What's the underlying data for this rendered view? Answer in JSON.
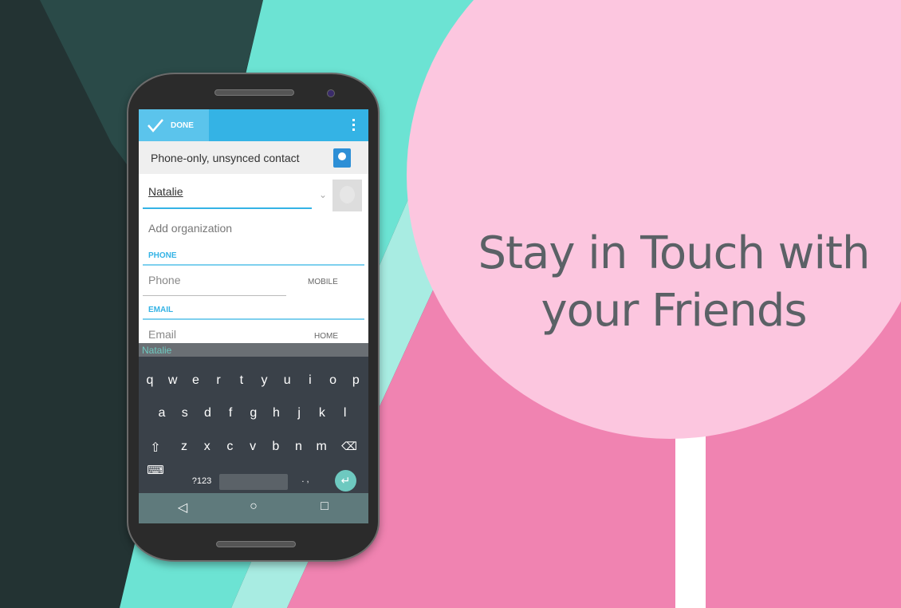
{
  "headline": {
    "line1": "Stay in Touch with",
    "line2": "your Friends"
  },
  "colors": {
    "action_bar": "#34b3e5",
    "accent": "#6ec9c0",
    "pink": "#f083b1",
    "light_pink": "#fcc6df",
    "teal": "#6ce3d3"
  },
  "action_bar": {
    "done_label": "DONE",
    "done_icon": "checkmark-icon",
    "overflow_icon": "overflow-menu-icon"
  },
  "account": {
    "label": "Phone-only, unsynced contact",
    "icon": "contact-card-icon"
  },
  "form": {
    "name_value": "Natalie",
    "org_placeholder": "Add organization",
    "phone_section": "PHONE",
    "phone_placeholder": "Phone",
    "phone_type": "MOBILE",
    "email_section": "EMAIL",
    "email_placeholder": "Email",
    "email_type": "HOME"
  },
  "keyboard": {
    "suggestion": "Natalie",
    "row1": [
      "q",
      "w",
      "e",
      "r",
      "t",
      "y",
      "u",
      "i",
      "o",
      "p"
    ],
    "row2": [
      "a",
      "s",
      "d",
      "f",
      "g",
      "h",
      "j",
      "k",
      "l"
    ],
    "row3": [
      "z",
      "x",
      "c",
      "v",
      "b",
      "n",
      "m"
    ],
    "symbols_label": "?123",
    "punct_label": ". ,"
  },
  "nav": {
    "back": "◁",
    "home": "○",
    "recents": "□"
  }
}
